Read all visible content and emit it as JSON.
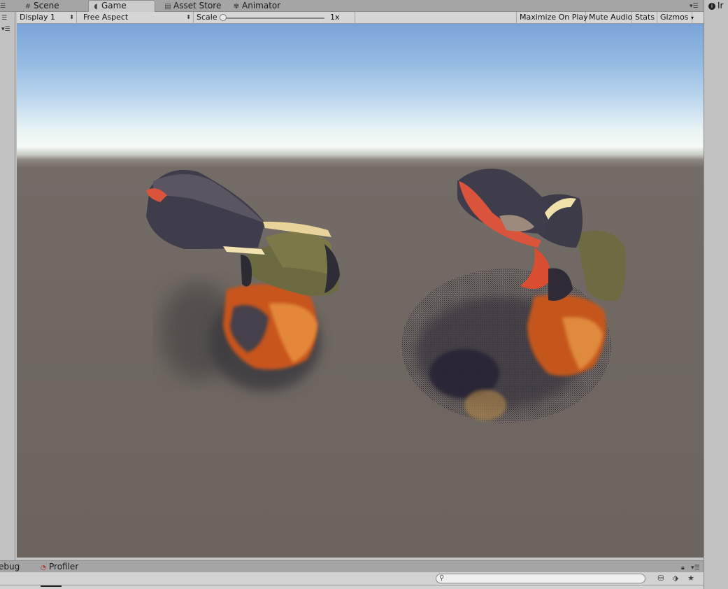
{
  "tabs": {
    "items": [
      {
        "label": "Scene",
        "icon": "scene-grid-icon"
      },
      {
        "label": "Game",
        "icon": "game-pacman-icon",
        "active": true
      },
      {
        "label": "Asset Store",
        "icon": "asset-store-icon"
      },
      {
        "label": "Animator",
        "icon": "animator-icon"
      }
    ]
  },
  "toolbar": {
    "display": "Display 1",
    "aspect": "Free Aspect",
    "scale_label": "Scale",
    "scale_value": "1x",
    "scale_fraction": 0.0,
    "maximize": "Maximize On Play",
    "mute": "Mute Audio",
    "stats": "Stats",
    "gizmos": "Gizmos"
  },
  "inspector": {
    "tab_label": "Ir"
  },
  "bottom": {
    "tabs": [
      {
        "label": "ebug"
      },
      {
        "label": "Profiler",
        "icon": "profiler-icon"
      }
    ],
    "search_placeholder": ""
  },
  "colors": {
    "sky_top": "#7aa4d8",
    "horizon": "#f5faf6",
    "ground": "#6f6862",
    "tab_active": "#cbcbcb",
    "toolbar_bg": "#d6d6d6"
  }
}
